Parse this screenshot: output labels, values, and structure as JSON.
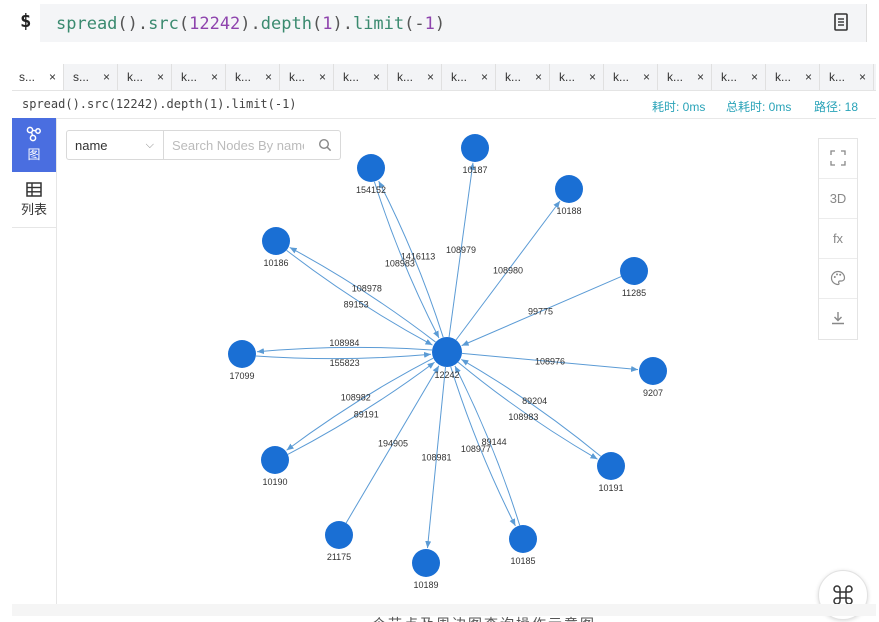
{
  "query": {
    "prompt": "$",
    "parts": [
      {
        "t": "spread",
        "c": "fn"
      },
      {
        "t": "().",
        "c": "dot"
      },
      {
        "t": "src",
        "c": "fn"
      },
      {
        "t": "(",
        "c": "dot"
      },
      {
        "t": "12242",
        "c": "num"
      },
      {
        "t": ").",
        "c": "dot"
      },
      {
        "t": "depth",
        "c": "fn"
      },
      {
        "t": "(",
        "c": "dot"
      },
      {
        "t": "1",
        "c": "num"
      },
      {
        "t": ").",
        "c": "dot"
      },
      {
        "t": "limit",
        "c": "fn"
      },
      {
        "t": "(-",
        "c": "dot"
      },
      {
        "t": "1",
        "c": "num"
      },
      {
        "t": ")",
        "c": "dot"
      }
    ]
  },
  "tabs": [
    {
      "label": "s...",
      "close": "×"
    },
    {
      "label": "s...",
      "close": "×"
    },
    {
      "label": "k...",
      "close": "×"
    },
    {
      "label": "k...",
      "close": "×"
    },
    {
      "label": "k...",
      "close": "×"
    },
    {
      "label": "k...",
      "close": "×"
    },
    {
      "label": "k...",
      "close": "×"
    },
    {
      "label": "k...",
      "close": "×"
    },
    {
      "label": "k...",
      "close": "×"
    },
    {
      "label": "k...",
      "close": "×"
    },
    {
      "label": "k...",
      "close": "×"
    },
    {
      "label": "k...",
      "close": "×"
    },
    {
      "label": "k...",
      "close": "×"
    },
    {
      "label": "k...",
      "close": "×"
    },
    {
      "label": "k...",
      "close": "×"
    },
    {
      "label": "k...",
      "close": "×"
    }
  ],
  "info": {
    "query_text": "spread().src(12242).depth(1).limit(-1)",
    "time": "耗时: 0ms",
    "total_time": "总耗时: 0ms",
    "paths": "路径: 18"
  },
  "sidebar": {
    "graph_label": "图",
    "list_label": "列表"
  },
  "filter": {
    "field": "name",
    "placeholder": "Search Nodes By name"
  },
  "tools": {
    "fullscreen_icon": "fullscreen-icon",
    "mode_3d": "3D",
    "fx": "fx",
    "palette_icon": "palette-icon",
    "download_icon": "download-icon"
  },
  "colors": {
    "node": "#1a6fd4",
    "edge": "#5b9bd5",
    "accent": "#4a6ee0",
    "stat": "#29a3b8"
  },
  "graph": {
    "center": "12242",
    "nodes": [
      "12242",
      "154152",
      "10187",
      "10188",
      "10186",
      "11285",
      "17099",
      "9207",
      "10190",
      "10191",
      "21175",
      "10189",
      "10185"
    ],
    "edges": [
      {
        "from": "12242",
        "to": "154152",
        "label": "1416113"
      },
      {
        "from": "154152",
        "to": "12242",
        "label": "108983"
      },
      {
        "from": "12242",
        "to": "10187",
        "label": "108979"
      },
      {
        "from": "12242",
        "to": "10188",
        "label": "108980"
      },
      {
        "from": "12242",
        "to": "10186",
        "label": "108978"
      },
      {
        "from": "10186",
        "to": "12242",
        "label": "89153"
      },
      {
        "from": "11285",
        "to": "12242",
        "label": "99775"
      },
      {
        "from": "12242",
        "to": "17099",
        "label": "108984"
      },
      {
        "from": "17099",
        "to": "12242",
        "label": "155823"
      },
      {
        "from": "12242",
        "to": "9207",
        "label": "108976"
      },
      {
        "from": "12242",
        "to": "10190",
        "label": "108982"
      },
      {
        "from": "10190",
        "to": "12242",
        "label": "89191"
      },
      {
        "from": "12242",
        "to": "10191",
        "label": "108983"
      },
      {
        "from": "10191",
        "to": "12242",
        "label": "89204"
      },
      {
        "from": "21175",
        "to": "12242",
        "label": "194905"
      },
      {
        "from": "12242",
        "to": "10189",
        "label": "108981"
      },
      {
        "from": "12242",
        "to": "10185",
        "label": "108977"
      },
      {
        "from": "10185",
        "to": "12242",
        "label": "89144"
      }
    ]
  },
  "caption": "个节点及周边图查询操作示意图"
}
